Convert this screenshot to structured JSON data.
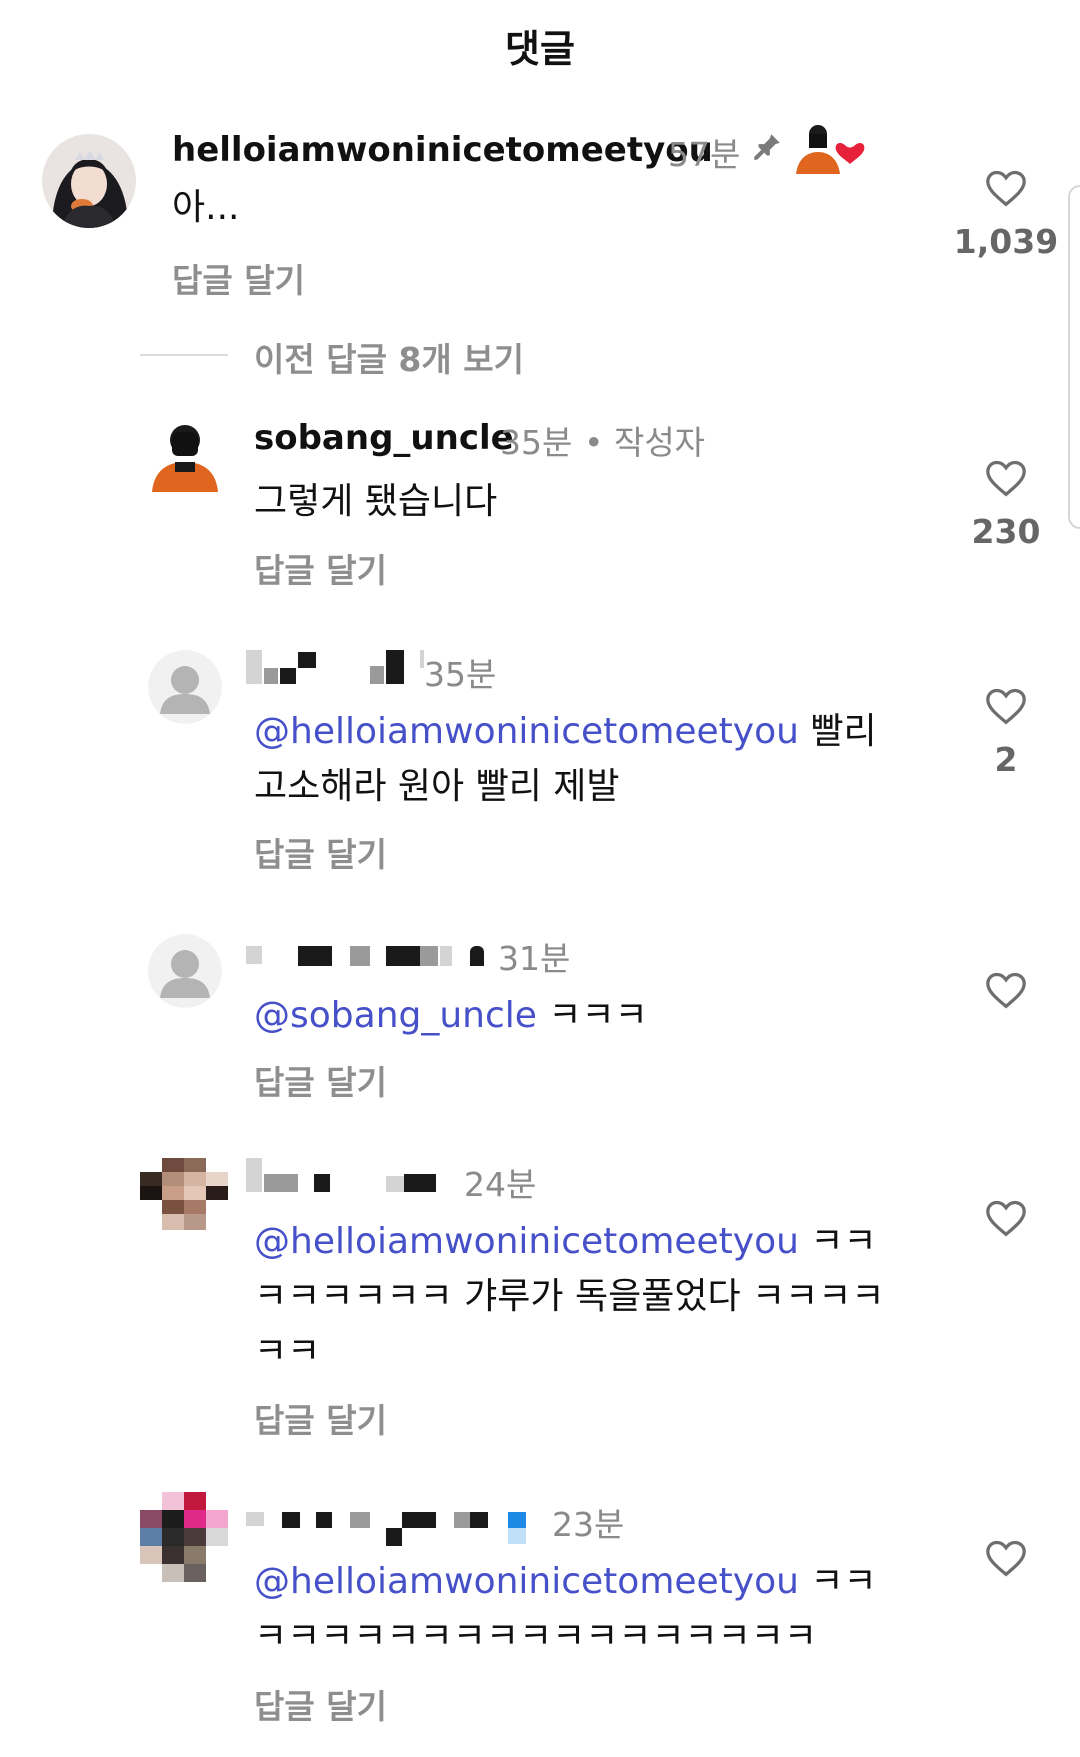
{
  "header": {
    "title": "댓글"
  },
  "colors": {
    "mention": "#4650c8",
    "muted": "#8e8e8e",
    "like_heart_badge": "#e8213b"
  },
  "comments": [
    {
      "username": "helloiamwoninicetomeetyou",
      "time": "57분",
      "pinned_icon": "pin-icon",
      "liked_by_creator": true,
      "text": "아...",
      "reply_label": "답글 달기",
      "likes": "1,039"
    }
  ],
  "view_replies": "이전 답글 8개 보기",
  "replies": [
    {
      "username": "sobang_uncle",
      "time": "35분",
      "tag": "• 작성자",
      "text": "그렇게 됐습니다",
      "reply_label": "답글 달기",
      "likes": "230"
    },
    {
      "username": "",
      "time": "35분",
      "mention": "@helloiamwoninicetomeetyou",
      "text_line1": " 빨리",
      "text_line2": "고소해라 원아 빨리 제발",
      "reply_label": "답글 달기",
      "likes": "2"
    },
    {
      "username": "",
      "time": "31분",
      "mention": "@sobang_uncle",
      "text_line1": " ㅋㅋㅋ",
      "reply_label": "답글 달기",
      "likes": ""
    },
    {
      "username": "",
      "time": "24분",
      "mention": "@helloiamwoninicetomeetyou",
      "text_line1": " ㅋㅋ",
      "text_line2": "ㅋㅋㅋㅋㅋㅋ 갸루가 독을풀었다 ㅋㅋㅋㅋ",
      "text_line3": "ㅋㅋ",
      "reply_label": "답글 달기",
      "likes": ""
    },
    {
      "username": "",
      "time": "23분",
      "mention": "@helloiamwoninicetomeetyou",
      "text_line1": " ㅋㅋ",
      "text_line2": "ㅋㅋㅋㅋㅋㅋㅋㅋㅋㅋㅋㅋㅋㅋㅋㅋㅋ",
      "reply_label": "답글 달기",
      "likes": ""
    }
  ]
}
